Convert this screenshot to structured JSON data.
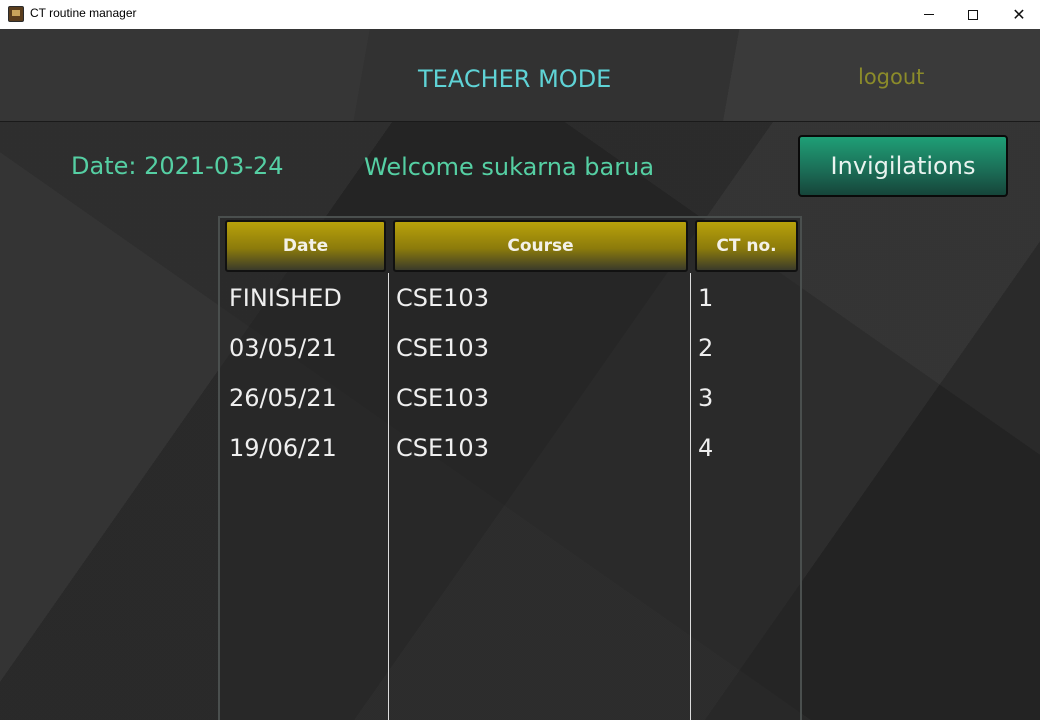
{
  "window": {
    "title": "CT routine manager",
    "minimize": "—",
    "maximize": "☐",
    "close": "✕"
  },
  "header": {
    "mode": "TEACHER MODE",
    "logout": "logout"
  },
  "info": {
    "date": "Date: 2021-03-24",
    "welcome": "Welcome sukarna barua"
  },
  "actions": {
    "invigilations": "Invigilations"
  },
  "table": {
    "headers": [
      "Date",
      "Course",
      "CT no."
    ],
    "rows": [
      [
        "FINISHED",
        "CSE103",
        "1"
      ],
      [
        "03/05/21",
        "CSE103",
        "2"
      ],
      [
        "26/05/21",
        "CSE103",
        "3"
      ],
      [
        "19/06/21",
        "CSE103",
        "4"
      ]
    ]
  },
  "colors": {
    "accent_teal": "#5fd3d6",
    "accent_green": "#55cfa3",
    "logout": "#8b8b2a",
    "header_gold": "#b9a20b",
    "button_green": "#1f9f76"
  }
}
